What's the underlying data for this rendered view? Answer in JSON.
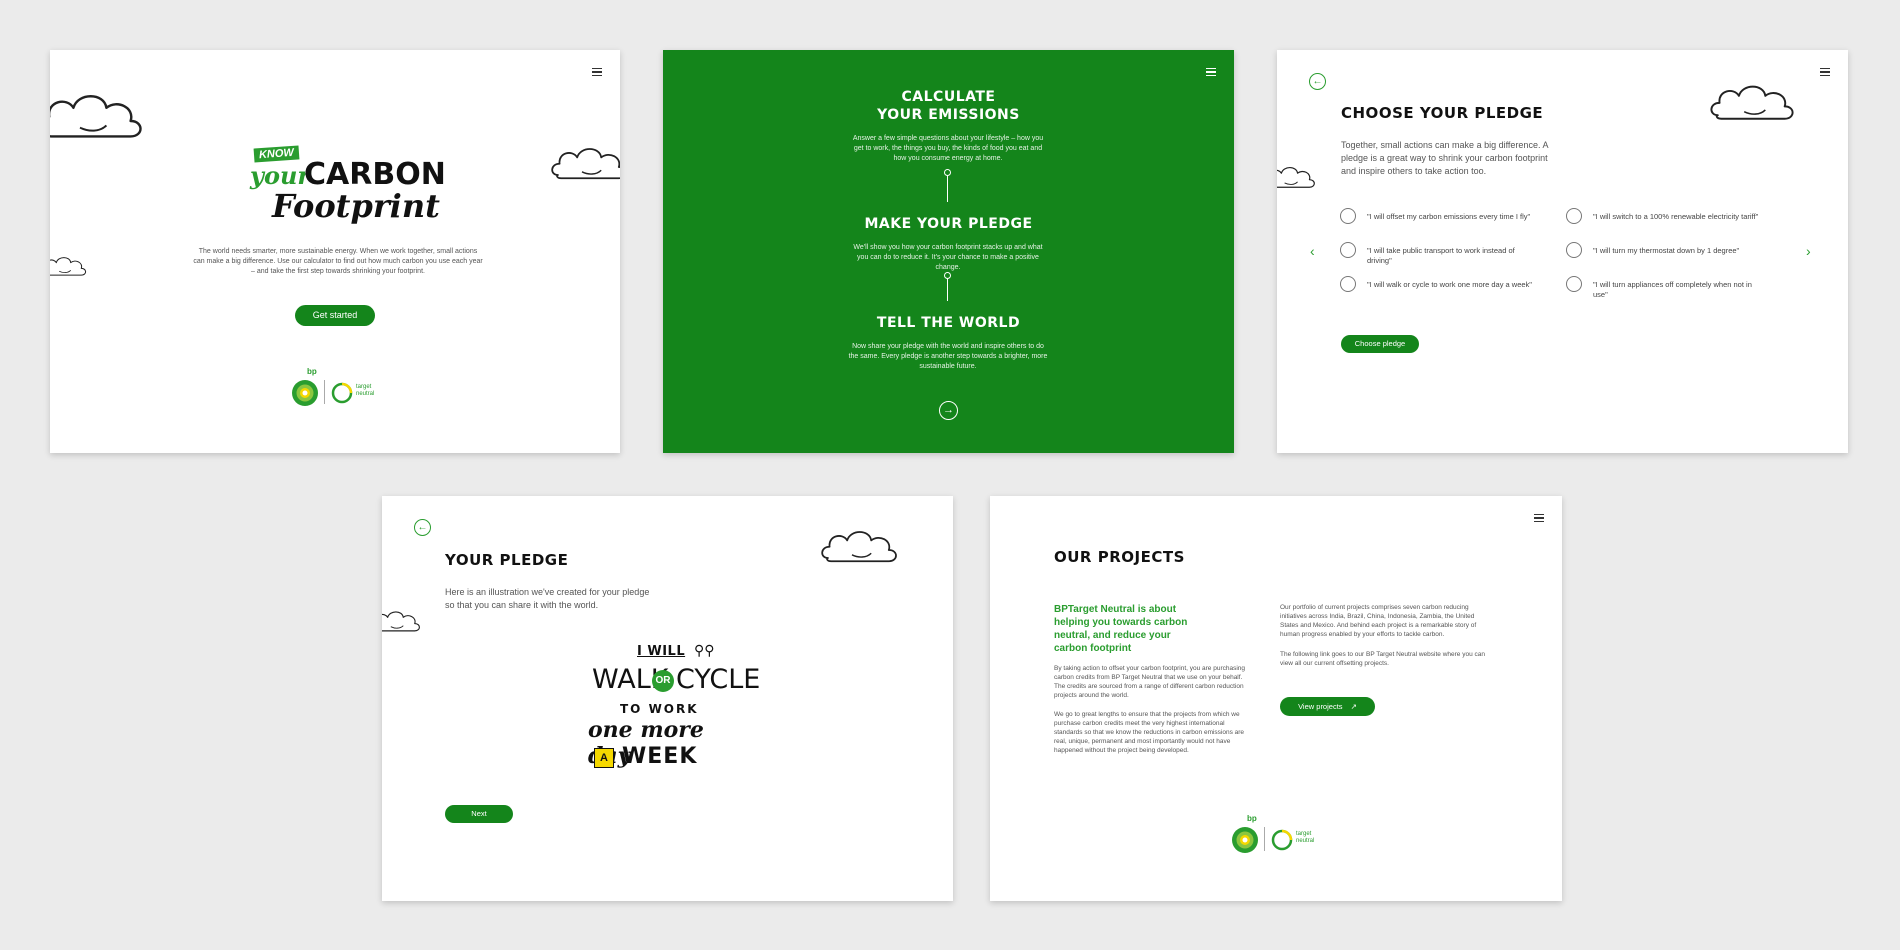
{
  "screen1": {
    "logo_know": "KNOW",
    "logo_your": "your",
    "logo_carbon": "CARBON",
    "logo_footprint": "Footprint",
    "intro": "The world needs smarter, more sustainable energy. When we work together, small actions can make a big difference. Use our calculator to find out how much carbon you use each year – and take the first step towards shrinking your footprint.",
    "cta": "Get started",
    "brand_bp": "bp",
    "brand_target": "target",
    "brand_neutral": "neutral"
  },
  "screen2": {
    "step1_title_a": "CALCULATE",
    "step1_title_b": "YOUR EMISSIONS",
    "step1_text": "Answer a few simple questions about your lifestyle – how you get to work, the things you buy, the kinds of food you eat and how you consume energy at home.",
    "step2_title": "MAKE YOUR PLEDGE",
    "step2_text": "We'll show you how your carbon footprint stacks up and what you can do to reduce it. It's your chance to make a positive change.",
    "step3_title": "TELL THE WORLD",
    "step3_text": "Now share your pledge with the world and inspire others to do the same. Every pledge is another step towards a brighter, more sustainable future."
  },
  "screen3": {
    "title": "CHOOSE YOUR PLEDGE",
    "intro": "Together, small actions can make a big difference. A pledge is a great way to shrink your carbon footprint and inspire others to take action too.",
    "options_left": [
      "\"I will offset my carbon emissions every time I fly\"",
      "\"I will take public transport to work instead of driving\"",
      "\"I will walk or cycle to work one more day a week\""
    ],
    "options_right": [
      "\"I will switch to a 100% renewable electricity tariff\"",
      "\"I will turn my thermostat down by 1 degree\"",
      "\"I will turn appliances off completely when not in use\""
    ],
    "cta": "Choose pledge"
  },
  "screen4": {
    "title": "YOUR PLEDGE",
    "intro": "Here is an illustration we've created for your pledge so that you can share it with the world.",
    "art_line1": "I WILL",
    "art_walk": "WALK",
    "art_or": "OR",
    "art_cycle": "CYCLE",
    "art_line3": "TO WORK",
    "art_line4": "one more day",
    "art_a": "A",
    "art_week": "WEEK",
    "cta": "Next"
  },
  "screen5": {
    "title": "OUR PROJECTS",
    "lead": "BPTarget Neutral is about helping you towards carbon neutral, and reduce your carbon footprint",
    "para1": "By taking action to offset your carbon footprint, you are purchasing carbon credits from BP Target Neutral that we use on your behalf. The credits are sourced from a range of different carbon reduction projects around the world.",
    "para2": "We go to great lengths to ensure that the projects from which we purchase carbon credits meet the very highest international standards so that we know the reductions in carbon emissions are real, unique, permanent and most importantly would not have happened without the project being developed.",
    "para3": "Our portfolio of current projects comprises seven carbon reducing initiatives across India, Brazil, China, Indonesia, Zambia, the United States and Mexico. And behind each project is a remarkable story of human progress enabled by your efforts to tackle carbon.",
    "para4": "The following link goes to our BP Target Neutral website where you can view all our current offsetting projects.",
    "cta": "View projects",
    "brand_bp": "bp",
    "brand_target": "target",
    "brand_neutral": "neutral"
  },
  "colors": {
    "green": "#14851b",
    "bright_green": "#2a9d2f",
    "yellow": "#f5d800"
  },
  "icons": [
    "menu-icon",
    "back-arrow-icon",
    "forward-arrow-icon",
    "chevron-left-icon",
    "chevron-right-icon",
    "cloud-icon",
    "external-link-icon",
    "bp-helios-logo",
    "target-neutral-logo",
    "bicycle-icon"
  ]
}
